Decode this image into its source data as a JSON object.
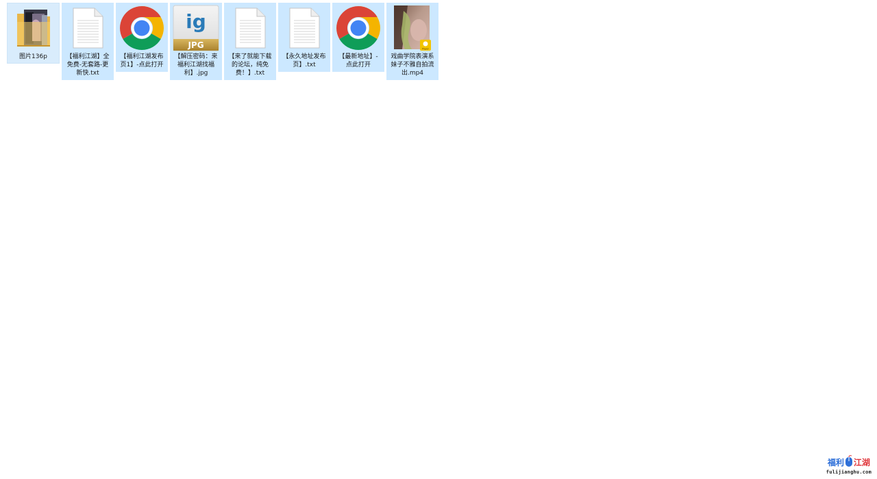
{
  "desktop": {
    "items": [
      {
        "type": "folder",
        "icon": "photo-folder-icon",
        "label": "图片136p"
      },
      {
        "type": "txt",
        "icon": "text-file-icon",
        "label": "【福利江湖】全免费-无套路-更新快.txt"
      },
      {
        "type": "shortcut",
        "icon": "chrome-icon",
        "label": "【福利江湖发布页1】-点此打开"
      },
      {
        "type": "jpg",
        "icon": "jpg-file-icon",
        "label": "【解压密码：来福利江湖找福利】.jpg",
        "badge": "JPG"
      },
      {
        "type": "txt",
        "icon": "text-file-icon",
        "label": "【来了就能下载的论坛，纯免费！】.txt"
      },
      {
        "type": "txt",
        "icon": "text-file-icon",
        "label": "【永久地址发布页】.txt"
      },
      {
        "type": "shortcut",
        "icon": "chrome-icon",
        "label": "【最新地址】-点此打开"
      },
      {
        "type": "video",
        "icon": "video-thumbnail-icon",
        "label": "戏曲学院表演系妹子不雅自拍流出.mp4",
        "badge": "Player"
      }
    ]
  },
  "watermark": {
    "logo": [
      "福利",
      "江湖"
    ],
    "url": "fulijianghu.com"
  },
  "colors": {
    "selection": "#cce8ff",
    "chrome_red": "#db4437",
    "chrome_green": "#0f9d58",
    "chrome_yellow": "#f4b400",
    "chrome_blue": "#4285f4",
    "jpg_gold": "#c9a24a"
  }
}
